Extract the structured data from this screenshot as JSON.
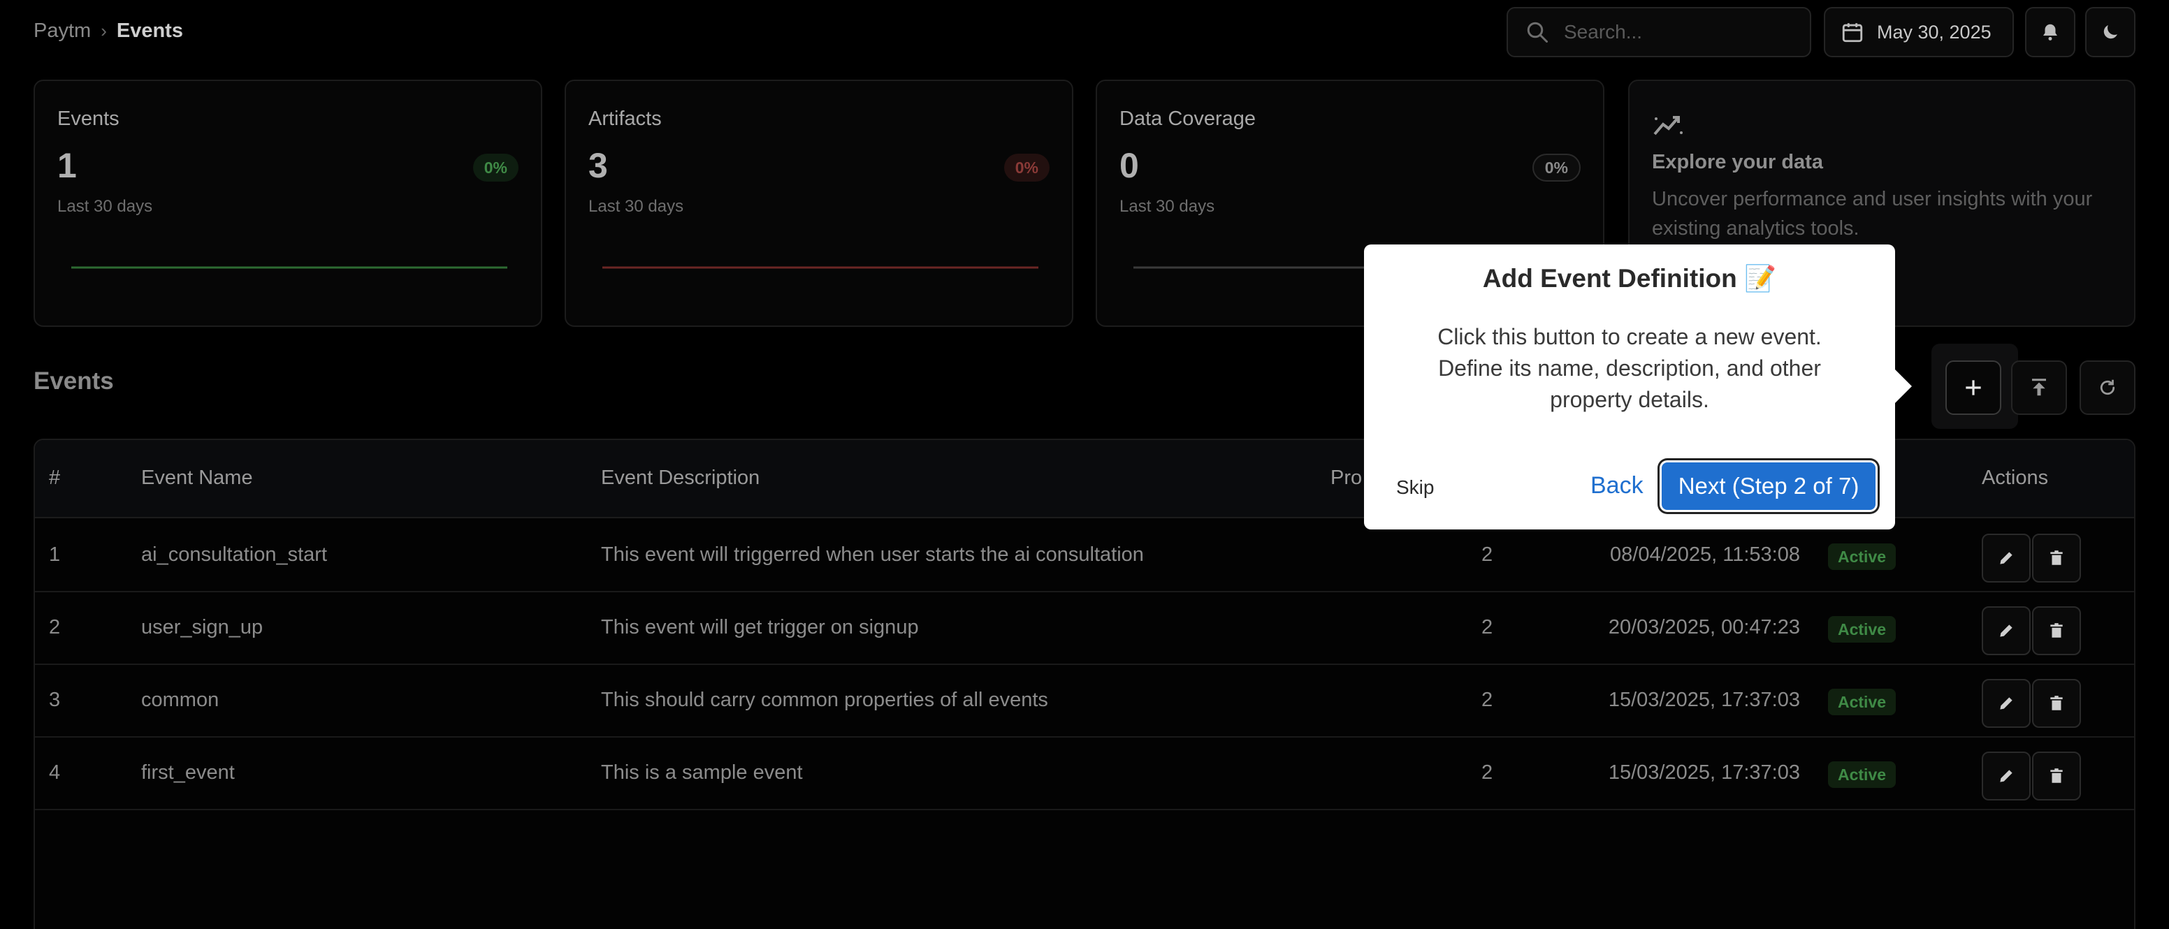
{
  "breadcrumb": {
    "root": "Paytm",
    "separator": "›",
    "current": "Events"
  },
  "search": {
    "placeholder": "Search..."
  },
  "date_picker": {
    "label": "May 30, 2025"
  },
  "stats": [
    {
      "label": "Events",
      "value": "1",
      "change": "0%",
      "sub": "Last 30 days",
      "trend_color": "#2d6b32"
    },
    {
      "label": "Artifacts",
      "value": "3",
      "change": "0%",
      "sub": "Last 30 days",
      "trend_color": "#6b2624"
    },
    {
      "label": "Data Coverage",
      "value": "0",
      "change": "0%",
      "sub": "Last 30 days",
      "trend_color": "#3a3a3a"
    }
  ],
  "explore": {
    "title": "Explore your data",
    "description": "Uncover performance and user insights with your existing analytics tools."
  },
  "events_section": {
    "title": "Events"
  },
  "table": {
    "headers": {
      "num": "#",
      "name": "Event Name",
      "description": "Event Description",
      "properties": "Pro",
      "actions": "Actions"
    },
    "rows": [
      {
        "num": "1",
        "name": "ai_consultation_start",
        "description": "This event will triggerred when user starts the ai consultation",
        "properties": "2",
        "updated": "08/04/2025, 11:53:08",
        "status": "Active"
      },
      {
        "num": "2",
        "name": "user_sign_up",
        "description": "This event will get trigger on signup",
        "properties": "2",
        "updated": "20/03/2025, 00:47:23",
        "status": "Active"
      },
      {
        "num": "3",
        "name": "common",
        "description": "This should carry common properties of all events",
        "properties": "2",
        "updated": "15/03/2025, 17:37:03",
        "status": "Active"
      },
      {
        "num": "4",
        "name": "first_event",
        "description": "This is a sample event",
        "properties": "2",
        "updated": "15/03/2025, 17:37:03",
        "status": "Active"
      }
    ]
  },
  "tour": {
    "title": "Add Event Definition 📝",
    "description": "Click this button to create a new event. Define its name, description, and other property details.",
    "skip": "Skip",
    "back": "Back",
    "next": "Next (Step 2 of 7)"
  },
  "colors": {
    "accent": "#1f6fcf",
    "active_badge": "#3f8a46",
    "background": "#000000"
  }
}
